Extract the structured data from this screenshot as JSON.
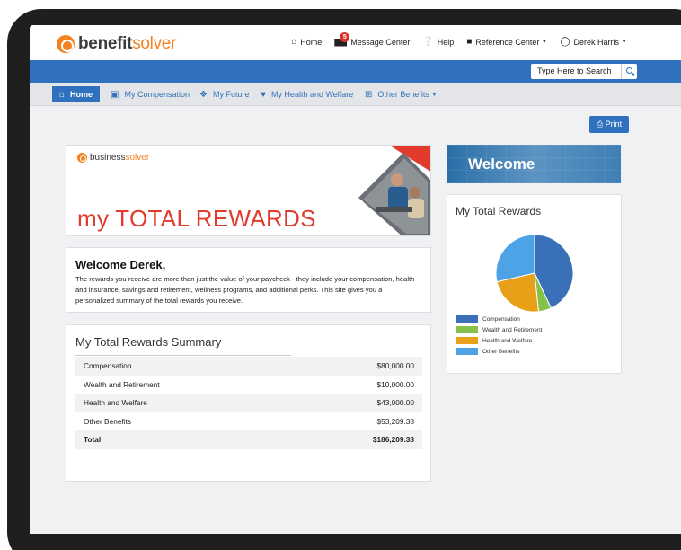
{
  "header": {
    "brand_main": "benefit",
    "brand_accent": "solver",
    "nav": [
      {
        "label": "Home",
        "icon": "home-icon"
      },
      {
        "label": "Message Center",
        "icon": "mail-icon",
        "badge": "5"
      },
      {
        "label": "Help",
        "icon": "help-icon"
      },
      {
        "label": "Reference Center",
        "icon": "book-icon",
        "dropdown": true
      },
      {
        "label": "Derek Harris",
        "icon": "user-icon",
        "dropdown": true
      }
    ]
  },
  "search": {
    "placeholder": "Type Here to Search"
  },
  "tabs": [
    {
      "label": "Home",
      "icon": "home-icon",
      "active": true
    },
    {
      "label": "My Compensation",
      "icon": "money-icon"
    },
    {
      "label": "My Future",
      "icon": "leaf-icon"
    },
    {
      "label": "My Health and Welfare",
      "icon": "heart-icon"
    },
    {
      "label": "Other Benefits",
      "icon": "plus-icon",
      "dropdown": true
    }
  ],
  "print_label": "Print",
  "hero": {
    "logo_main": "business",
    "logo_accent": "solver",
    "title": "my TOTAL REWARDS"
  },
  "welcome": {
    "title": "Welcome Derek,",
    "body": "The rewards you receive are more than just the value of your paycheck - they include your compensation, health and insurance, savings and retirement, wellness programs, and additional perks. This site gives you a personalized summary of the total rewards you receive."
  },
  "summary": {
    "title": "My Total Rewards Summary",
    "rows": [
      {
        "label": "Compensation",
        "value": "$80,000.00"
      },
      {
        "label": "Wealth and Retirement",
        "value": "$10,000.00"
      },
      {
        "label": "Health and Welfare",
        "value": "$43,000.00"
      },
      {
        "label": "Other Benefits",
        "value": "$53,209.38"
      }
    ],
    "total": {
      "label": "Total",
      "value": "$186,209.38"
    }
  },
  "sidebar": {
    "banner": "Welcome",
    "chart_title": "My Total Rewards"
  },
  "chart_data": {
    "type": "pie",
    "categories": [
      "Compensation",
      "Wealth and Retirement",
      "Health and Welfare",
      "Other Benefits"
    ],
    "values": [
      80000.0,
      10000.0,
      43000.0,
      53209.38
    ],
    "colors": [
      "#3a70b8",
      "#86c24a",
      "#e8a018",
      "#4da3e6"
    ],
    "legend_position": "bottom-left"
  },
  "colors": {
    "primary": "#2f71bd",
    "accent_orange": "#f58220",
    "title_red": "#e03b2d"
  }
}
